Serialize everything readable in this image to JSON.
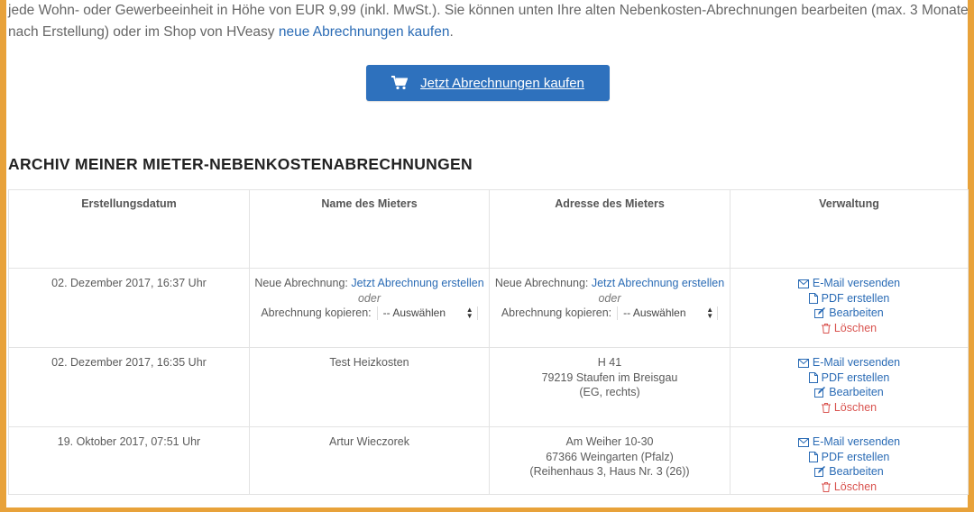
{
  "intro": {
    "line1": "jede Wohn- oder Gewerbeeinheit in Höhe von EUR 9,99 (inkl. MwSt.). Sie können unten Ihre alten Nebenkosten-Abrechnungen bearbeiten (max. 3 Monate",
    "line2_prefix": "nach Erstellung) oder im Shop von HVeasy ",
    "line2_link": "neue Abrechnungen kaufen",
    "line2_suffix": "."
  },
  "buy_button": {
    "label": "Jetzt Abrechnungen kaufen",
    "icon": "shopping-cart-icon"
  },
  "archive": {
    "heading": "ARCHIV MEINER MIETER-NEBENKOSTENABRECHNUNGEN",
    "columns": [
      "Erstellungsdatum",
      "Name des Mieters",
      "Adresse des Mieters",
      "Verwaltung"
    ],
    "new_row": {
      "date": "02. Dezember 2017, 16:37 Uhr",
      "new_label": "Neue Abrechnung:",
      "new_link": "Jetzt Abrechnung erstellen",
      "or": "oder",
      "copy_label": "Abrechnung kopieren:",
      "select_value": "-- Auswählen"
    },
    "rows": [
      {
        "date": "02. Dezember 2017, 16:35 Uhr",
        "name": "Test Heizkosten",
        "address": [
          "H 41",
          "79219 Staufen im Breisgau",
          "(EG, rechts)"
        ]
      },
      {
        "date": "19. Oktober 2017, 07:51 Uhr",
        "name": "Artur Wieczorek",
        "address": [
          "Am Weiher 10-30",
          "67366 Weingarten (Pfalz)",
          "(Reihenhaus 3, Haus Nr. 3 (26))"
        ]
      }
    ],
    "actions": {
      "email": "E-Mail versenden",
      "pdf": "PDF erstellen",
      "edit": "Bearbeiten",
      "delete": "Löschen"
    }
  },
  "colors": {
    "accent_border": "#e8a23a",
    "button": "#2e71bd",
    "link": "#2a6bb5",
    "delete": "#d9534f"
  }
}
